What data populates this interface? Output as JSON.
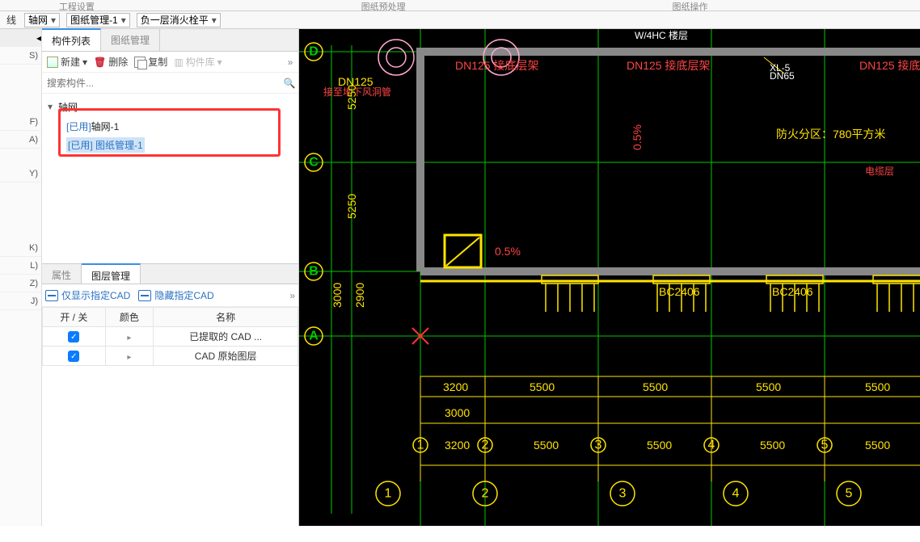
{
  "topgroups": [
    "工程设置",
    "",
    "图纸预处理",
    "",
    "图纸操作",
    ""
  ],
  "dd": {
    "a": "线",
    "b": "轴网",
    "c": "图纸管理-1",
    "d": "负一层消火栓平"
  },
  "left_shortcuts": [
    "S)",
    "",
    "F)",
    "A)",
    "",
    "Y)",
    "",
    "",
    "K)",
    "L)",
    "Z)",
    "J)",
    "",
    "",
    "",
    "",
    "",
    "",
    ""
  ],
  "tabs": {
    "a": "构件列表",
    "b": "图纸管理"
  },
  "subbar": {
    "new": "新建",
    "del": "删除",
    "copy": "复制",
    "lib": "构件库"
  },
  "search": {
    "placeholder": "搜索构件..."
  },
  "tree": {
    "root": "轴网",
    "r_used": "[已用] ",
    "n1": "轴网-1",
    "n2": "图纸管理-1"
  },
  "lowtabs": {
    "a": "属性",
    "b": "图层管理"
  },
  "layerbtn": {
    "a": "仅显示指定CAD",
    "b": "隐藏指定CAD"
  },
  "table": {
    "h1": "开 / 关",
    "h2": "颜色",
    "h3": "名称",
    "r1": "已提取的 CAD ...",
    "r2": "CAD 原始图层"
  },
  "cad": {
    "dn125": "DN125",
    "xl": "XL-5",
    "xln": "DN65",
    "fire": "防火分区：780平方米",
    "elec": "电缆层",
    "p05": "0.5%",
    "bc": "BC2406",
    "dn125top": "DN125 接底层架",
    "toplabel": "W/4HC 楼层",
    "under": "接至地下风洞管",
    "h": {
      "3200": "3200",
      "5500": "5500",
      "3000": "3000"
    },
    "v": {
      "5250": "5250",
      "3000": "3000",
      "2900": "2900"
    },
    "bub": [
      "1",
      "2",
      "3",
      "4",
      "5"
    ],
    "axis": [
      "A",
      "B",
      "C",
      "D"
    ]
  }
}
